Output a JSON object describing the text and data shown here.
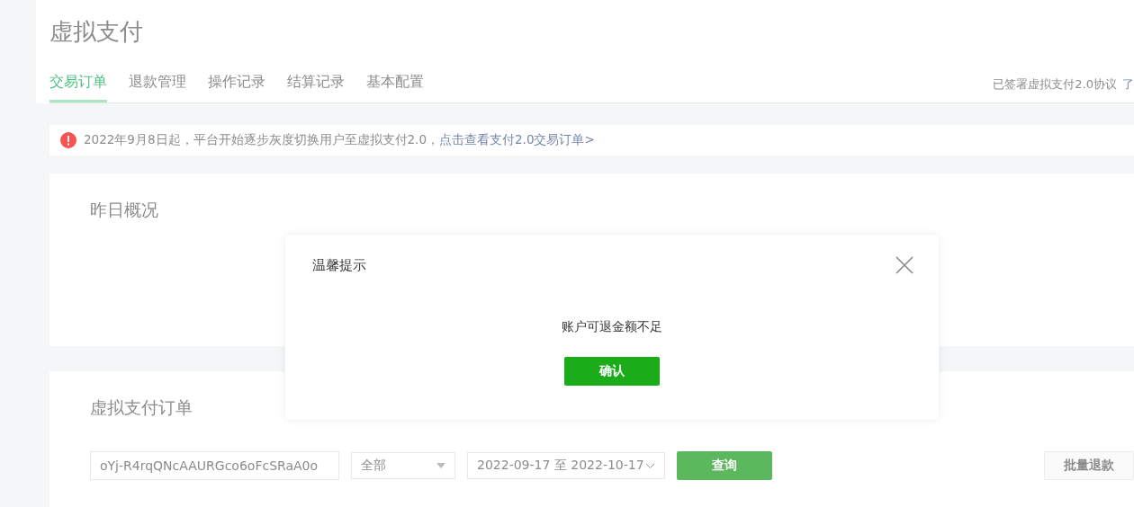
{
  "page": {
    "title": "虚拟支付"
  },
  "tabs": [
    {
      "label": "交易订单",
      "selected": true
    },
    {
      "label": "退款管理",
      "selected": false
    },
    {
      "label": "操作记录",
      "selected": false
    },
    {
      "label": "结算记录",
      "selected": false
    },
    {
      "label": "基本配置",
      "selected": false
    }
  ],
  "agreement": {
    "text": "已签署虚拟支付2.0协议",
    "link": "了"
  },
  "notice": {
    "text": "2022年9月8日起，平台开始逐步灰度切换用户至虚拟支付2.0，",
    "link": "点击查看支付2.0交易订单>"
  },
  "overview": {
    "title": "昨日概况"
  },
  "orders": {
    "title": "虚拟支付订单",
    "search_value": "oYj-R4rqQNcAAURGco6oFcSRaA0o",
    "status_select": "全部",
    "date_range": "2022-09-17 至 2022-10-17",
    "query_button": "查询",
    "batch_refund_button": "批量退款"
  },
  "dialog": {
    "title": "温馨提示",
    "message": "账户可退金额不足",
    "confirm_button": "确认"
  }
}
